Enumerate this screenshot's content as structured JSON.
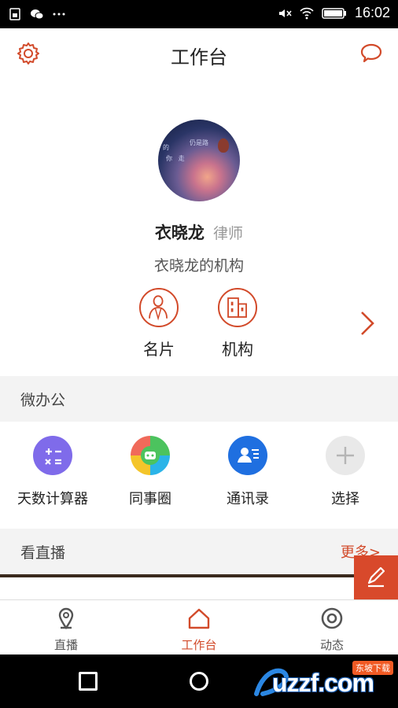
{
  "status_bar": {
    "time": "16:02"
  },
  "header": {
    "title": "工作台",
    "settings_icon": "gear-icon",
    "message_icon": "chat-bubble-icon"
  },
  "profile": {
    "name": "衣晓龙",
    "role": "律师",
    "organization": "衣晓龙的机构",
    "actions": [
      {
        "label": "名片",
        "icon": "person-card-icon"
      },
      {
        "label": "机构",
        "icon": "building-icon"
      }
    ]
  },
  "micro_office": {
    "title": "微办公",
    "items": [
      {
        "label": "天数计算器",
        "icon": "calculator-icon",
        "color": "#7f6bea"
      },
      {
        "label": "同事圈",
        "icon": "colleague-circle-icon",
        "color": "#4cc35e"
      },
      {
        "label": "通讯录",
        "icon": "contacts-icon",
        "color": "#1f6fe0"
      },
      {
        "label": "选择",
        "icon": "plus-icon",
        "color": "#e9e9e9"
      }
    ]
  },
  "live": {
    "title": "看直播",
    "more_label": "更多>"
  },
  "bottom_nav": [
    {
      "label": "直播",
      "icon": "live-pin-icon",
      "active": false
    },
    {
      "label": "工作台",
      "icon": "home-icon",
      "active": true
    },
    {
      "label": "动态",
      "icon": "target-icon",
      "active": false
    }
  ],
  "watermark": {
    "logo_text": "uzzf.com",
    "badge": "东坡下载"
  },
  "colors": {
    "accent": "#d24a2a",
    "section_bg": "#f3f3f3"
  }
}
